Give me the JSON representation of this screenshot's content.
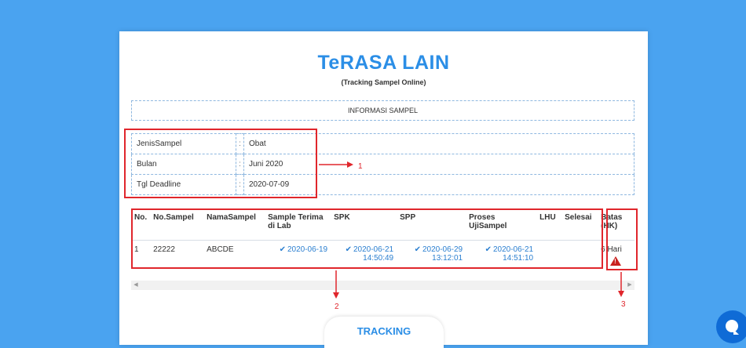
{
  "page": {
    "title": "TeRASA LAIN",
    "subtitle": "(Tracking Sampel Online)"
  },
  "info_section": {
    "header": "INFORMASI SAMPEL",
    "rows": [
      {
        "label": "JenisSampel",
        "sep": ":",
        "value": "Obat"
      },
      {
        "label": "Bulan",
        "sep": ":",
        "value": "Juni 2020"
      },
      {
        "label": "Tgl Deadline",
        "sep": ":",
        "value": "2020-07-09"
      }
    ]
  },
  "sample_table": {
    "headers": {
      "no": "No.",
      "no_sampel": "No.Sampel",
      "nama": "NamaSampel",
      "terima": "Sample Terima di Lab",
      "spk": "SPK",
      "spp": "SPP",
      "proses": "Proses UjiSampel",
      "lhu": "LHU",
      "selesai": "Selesai",
      "batas": "Batas (HK)"
    },
    "row": {
      "no": "1",
      "no_sampel": "22222",
      "nama": "ABCDE",
      "terima": "2020-06-19",
      "spk_date": "2020-06-21",
      "spk_time": "14:50:49",
      "spp_date": "2020-06-29",
      "spp_time": "13:12:01",
      "proses_date": "2020-06-21",
      "proses_time": "14:51:10",
      "lhu": "",
      "selesai": "",
      "batas": "6 Hari"
    }
  },
  "buttons": {
    "tracking": "TRACKING"
  },
  "annotations": {
    "one": "1",
    "two": "2",
    "three": "3"
  },
  "icons": {
    "check": "check-icon",
    "warning": "warning-icon",
    "chat": "chat-icon"
  },
  "colors": {
    "background": "#4aa3f0",
    "accent": "#2b8ee6",
    "annotation": "#e0262c",
    "warning": "#c9211e"
  }
}
